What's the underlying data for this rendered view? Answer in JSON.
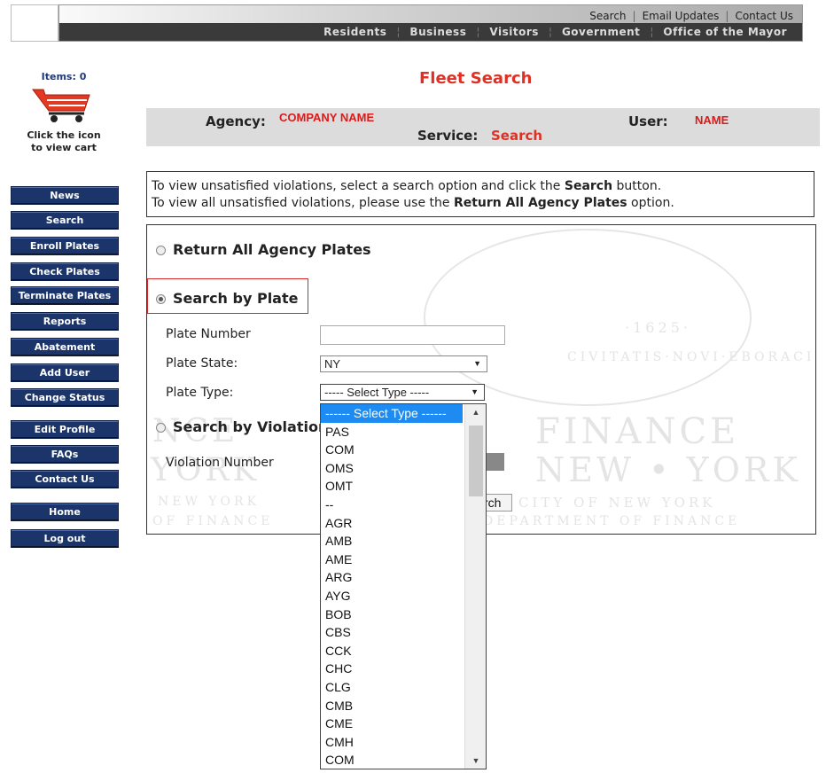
{
  "header": {
    "utility_links": [
      "Search",
      "Email Updates",
      "Contact Us"
    ],
    "main_nav": [
      "Residents",
      "Business",
      "Visitors",
      "Government",
      "Office of the Mayor"
    ]
  },
  "cart": {
    "items_label": "Items: 0",
    "hint_line1": "Click the icon",
    "hint_line2": "to view cart"
  },
  "sidebar": {
    "items": [
      "News",
      "Search",
      "Enroll Plates",
      "Check Plates",
      "Terminate Plates",
      "Reports",
      "Abatement",
      "Add User",
      "Change Status",
      "Edit Profile",
      "FAQs",
      "Contact Us",
      "Home",
      "Log out"
    ]
  },
  "page": {
    "title": "Fleet Search",
    "agency_label": "Agency:",
    "agency_value": "COMPANY NAME",
    "user_label": "User:",
    "user_value": "NAME",
    "service_label": "Service:",
    "service_value": "Search"
  },
  "instructions": {
    "line1_a": "To view unsatisfied violations, select a search option and click the ",
    "line1_b": "Search",
    "line1_c": " button.",
    "line2_a": "To view all unsatisfied violations, please use the ",
    "line2_b": "Return All Agency Plates",
    "line2_c": " option."
  },
  "search": {
    "opt_all": "Return All Agency Plates",
    "opt_plate": "Search by Plate",
    "opt_violation": "Search by Violation",
    "plate_number_label": "Plate Number",
    "plate_state_label": "Plate State:",
    "plate_state_value": "NY",
    "plate_type_label": "Plate Type:",
    "plate_type_value": "----- Select Type -----",
    "violation_number_label": "Violation Number",
    "button_partial": "rch",
    "selected_option": "plate"
  },
  "plate_type_options": [
    "------ Select Type ------",
    "PAS",
    "COM",
    "OMS",
    "OMT",
    "--",
    "AGR",
    "AMB",
    "AME",
    "ARG",
    "AYG",
    "BOB",
    "CBS",
    "CCK",
    "CHC",
    "CLG",
    "CMB",
    "CME",
    "CMH",
    "COM"
  ],
  "watermark": {
    "word1": "FINANCE",
    "word2": "NEW • YORK",
    "word3": "CITY OF NEW YORK",
    "word4": "DEPARTMENT OF FINANCE",
    "word5": "NCE",
    "word6": "YORK",
    "word7": "NEW YORK",
    "word8": "OF FINANCE",
    "seal_year": "·1625·",
    "seal_motto": "CIVITATIS·NOVI·EBORACI"
  },
  "colors": {
    "accent_red": "#e03024",
    "nav_blue": "#1b356b",
    "dropdown_highlight": "#1e8bf2"
  }
}
